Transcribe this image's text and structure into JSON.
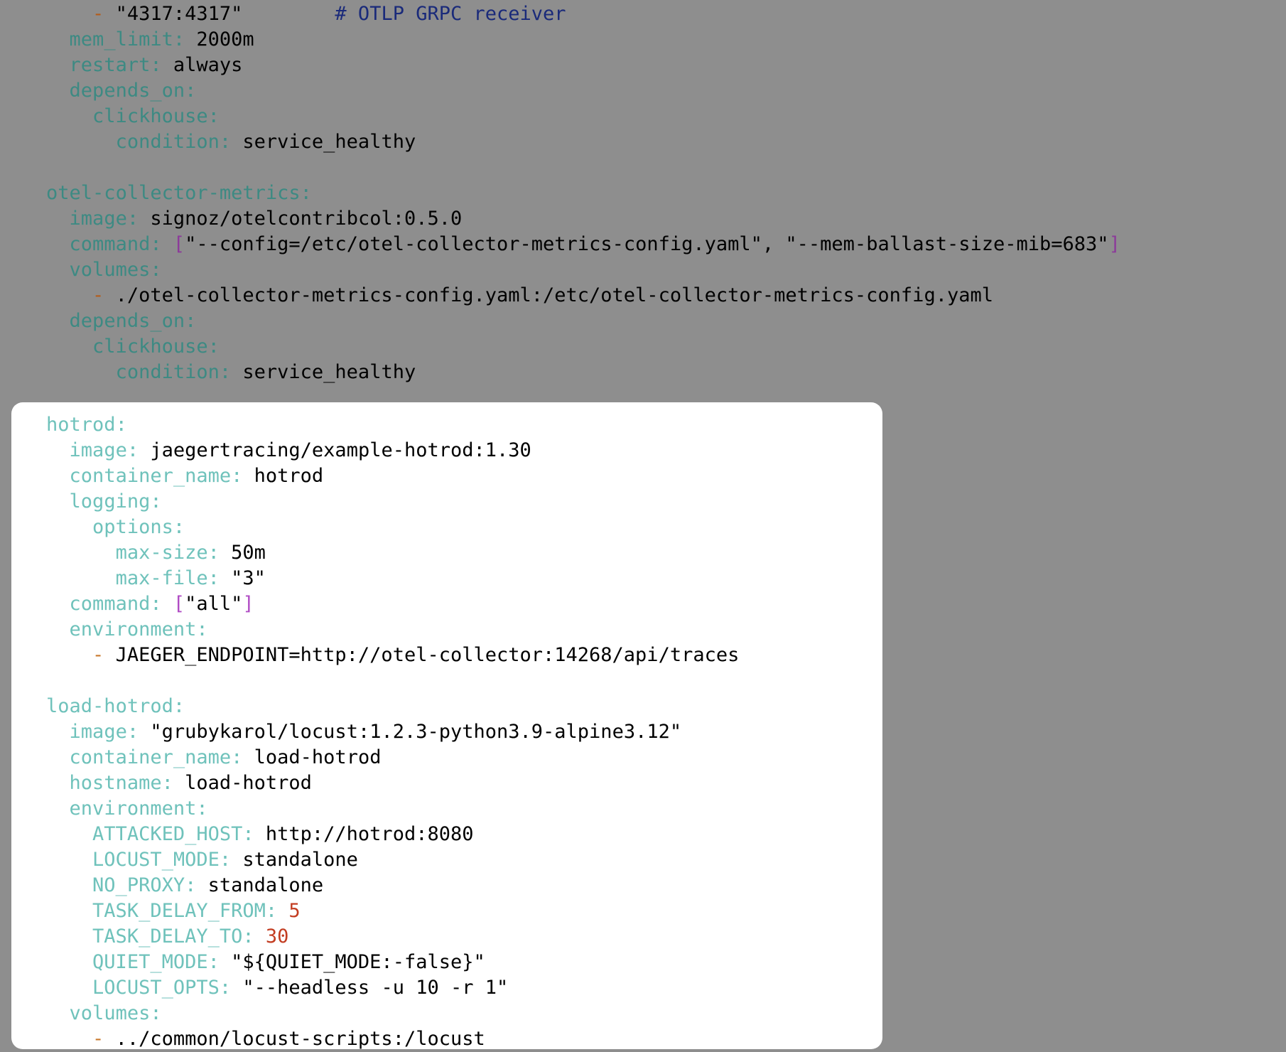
{
  "dimmed_lines": [
    {
      "indent": "    ",
      "parts": [
        {
          "t": "ind",
          "v": "- "
        },
        {
          "t": "s",
          "v": "\"4317:4317\"        "
        },
        {
          "t": "cmt",
          "v": "# OTLP GRPC receiver"
        }
      ]
    },
    {
      "indent": "  ",
      "parts": [
        {
          "t": "k",
          "v": "mem_limit:"
        },
        {
          "t": "s",
          "v": " 2000m"
        }
      ]
    },
    {
      "indent": "  ",
      "parts": [
        {
          "t": "k",
          "v": "restart:"
        },
        {
          "t": "s",
          "v": " always"
        }
      ]
    },
    {
      "indent": "  ",
      "parts": [
        {
          "t": "k",
          "v": "depends_on:"
        }
      ]
    },
    {
      "indent": "    ",
      "parts": [
        {
          "t": "k",
          "v": "clickhouse:"
        }
      ]
    },
    {
      "indent": "      ",
      "parts": [
        {
          "t": "k",
          "v": "condition:"
        },
        {
          "t": "s",
          "v": " service_healthy"
        }
      ]
    },
    {
      "indent": "",
      "parts": []
    },
    {
      "indent": "",
      "parts": [
        {
          "t": "k",
          "v": "otel-collector-metrics:"
        }
      ]
    },
    {
      "indent": "  ",
      "parts": [
        {
          "t": "k",
          "v": "image:"
        },
        {
          "t": "s",
          "v": " signoz/otelcontribcol:0.5.0"
        }
      ]
    },
    {
      "indent": "  ",
      "parts": [
        {
          "t": "k",
          "v": "command:"
        },
        {
          "t": "s",
          "v": " "
        },
        {
          "t": "br",
          "v": "["
        },
        {
          "t": "s",
          "v": "\"--config=/etc/otel-collector-metrics-config.yaml\", \"--mem-ballast-size-mib=683\""
        },
        {
          "t": "br",
          "v": "]"
        }
      ]
    },
    {
      "indent": "  ",
      "parts": [
        {
          "t": "k",
          "v": "volumes:"
        }
      ]
    },
    {
      "indent": "    ",
      "parts": [
        {
          "t": "ind",
          "v": "- "
        },
        {
          "t": "s",
          "v": "./otel-collector-metrics-config.yaml:/etc/otel-collector-metrics-config.yaml"
        }
      ]
    },
    {
      "indent": "  ",
      "parts": [
        {
          "t": "k",
          "v": "depends_on:"
        }
      ]
    },
    {
      "indent": "    ",
      "parts": [
        {
          "t": "k",
          "v": "clickhouse:"
        }
      ]
    },
    {
      "indent": "      ",
      "parts": [
        {
          "t": "k",
          "v": "condition:"
        },
        {
          "t": "s",
          "v": " service_healthy"
        }
      ]
    }
  ],
  "highlighted_lines": [
    {
      "indent": "",
      "parts": [
        {
          "t": "k",
          "v": "hotrod:"
        }
      ]
    },
    {
      "indent": "  ",
      "parts": [
        {
          "t": "k",
          "v": "image:"
        },
        {
          "t": "s",
          "v": " jaegertracing/example-hotrod:1.30"
        }
      ]
    },
    {
      "indent": "  ",
      "parts": [
        {
          "t": "k",
          "v": "container_name:"
        },
        {
          "t": "s",
          "v": " hotrod"
        }
      ]
    },
    {
      "indent": "  ",
      "parts": [
        {
          "t": "k",
          "v": "logging:"
        }
      ]
    },
    {
      "indent": "    ",
      "parts": [
        {
          "t": "k",
          "v": "options:"
        }
      ]
    },
    {
      "indent": "      ",
      "parts": [
        {
          "t": "k",
          "v": "max-size:"
        },
        {
          "t": "s",
          "v": " 50m"
        }
      ]
    },
    {
      "indent": "      ",
      "parts": [
        {
          "t": "k",
          "v": "max-file:"
        },
        {
          "t": "s",
          "v": " \"3\""
        }
      ]
    },
    {
      "indent": "  ",
      "parts": [
        {
          "t": "k",
          "v": "command:"
        },
        {
          "t": "s",
          "v": " "
        },
        {
          "t": "br",
          "v": "["
        },
        {
          "t": "s",
          "v": "\"all\""
        },
        {
          "t": "br",
          "v": "]"
        }
      ]
    },
    {
      "indent": "  ",
      "parts": [
        {
          "t": "k",
          "v": "environment:"
        }
      ]
    },
    {
      "indent": "    ",
      "parts": [
        {
          "t": "ind",
          "v": "- "
        },
        {
          "t": "s",
          "v": "JAEGER_ENDPOINT=http://otel-collector:14268/api/traces"
        }
      ]
    },
    {
      "indent": "",
      "parts": []
    },
    {
      "indent": "",
      "parts": [
        {
          "t": "k",
          "v": "load-hotrod:"
        }
      ]
    },
    {
      "indent": "  ",
      "parts": [
        {
          "t": "k",
          "v": "image:"
        },
        {
          "t": "s",
          "v": " \"grubykarol/locust:1.2.3-python3.9-alpine3.12\""
        }
      ]
    },
    {
      "indent": "  ",
      "parts": [
        {
          "t": "k",
          "v": "container_name:"
        },
        {
          "t": "s",
          "v": " load-hotrod"
        }
      ]
    },
    {
      "indent": "  ",
      "parts": [
        {
          "t": "k",
          "v": "hostname:"
        },
        {
          "t": "s",
          "v": " load-hotrod"
        }
      ]
    },
    {
      "indent": "  ",
      "parts": [
        {
          "t": "k",
          "v": "environment:"
        }
      ]
    },
    {
      "indent": "    ",
      "parts": [
        {
          "t": "k",
          "v": "ATTACKED_HOST:"
        },
        {
          "t": "s",
          "v": " http://hotrod:8080"
        }
      ]
    },
    {
      "indent": "    ",
      "parts": [
        {
          "t": "k",
          "v": "LOCUST_MODE:"
        },
        {
          "t": "s",
          "v": " standalone"
        }
      ]
    },
    {
      "indent": "    ",
      "parts": [
        {
          "t": "k",
          "v": "NO_PROXY:"
        },
        {
          "t": "s",
          "v": " standalone"
        }
      ]
    },
    {
      "indent": "    ",
      "parts": [
        {
          "t": "k",
          "v": "TASK_DELAY_FROM:"
        },
        {
          "t": "s",
          "v": " "
        },
        {
          "t": "num",
          "v": "5"
        }
      ]
    },
    {
      "indent": "    ",
      "parts": [
        {
          "t": "k",
          "v": "TASK_DELAY_TO:"
        },
        {
          "t": "s",
          "v": " "
        },
        {
          "t": "num",
          "v": "30"
        }
      ]
    },
    {
      "indent": "    ",
      "parts": [
        {
          "t": "k",
          "v": "QUIET_MODE:"
        },
        {
          "t": "s",
          "v": " \"${QUIET_MODE:-false}\""
        }
      ]
    },
    {
      "indent": "    ",
      "parts": [
        {
          "t": "k",
          "v": "LOCUST_OPTS:"
        },
        {
          "t": "s",
          "v": " \"--headless -u 10 -r 1\""
        }
      ]
    },
    {
      "indent": "  ",
      "parts": [
        {
          "t": "k",
          "v": "volumes:"
        }
      ]
    },
    {
      "indent": "    ",
      "parts": [
        {
          "t": "ind",
          "v": "- "
        },
        {
          "t": "s",
          "v": "../common/locust-scripts:/locust"
        }
      ]
    }
  ]
}
